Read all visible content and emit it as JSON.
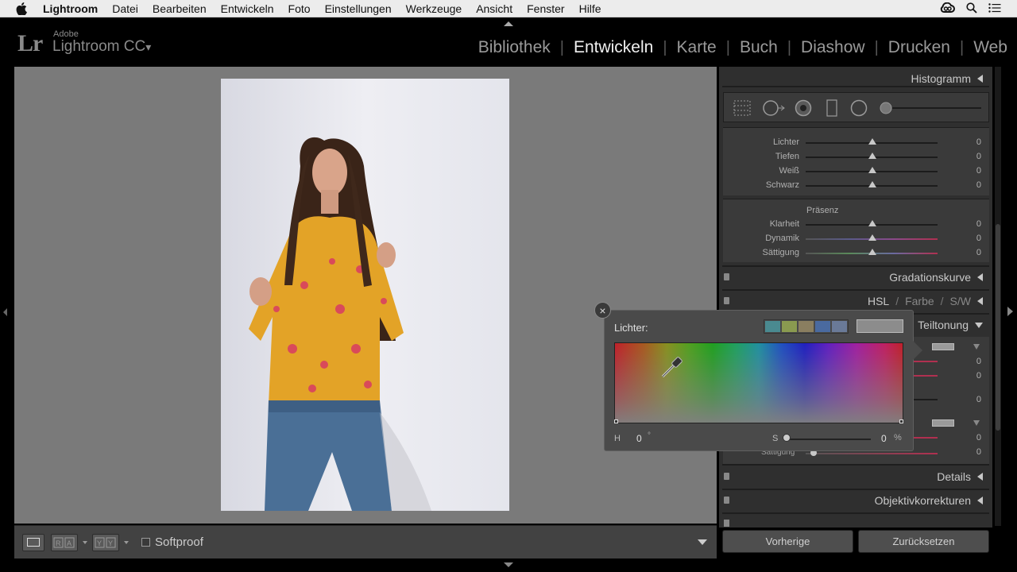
{
  "menubar": {
    "app_name": "Lightroom",
    "items": [
      "Datei",
      "Bearbeiten",
      "Entwickeln",
      "Foto",
      "Einstellungen",
      "Werkzeuge",
      "Ansicht",
      "Fenster",
      "Hilfe"
    ]
  },
  "header": {
    "logo": "Lr",
    "vendor": "Adobe",
    "product": "Lightroom CC",
    "product_caret": "▾",
    "modules": [
      {
        "label": "Bibliothek",
        "active": false
      },
      {
        "label": "Entwickeln",
        "active": true
      },
      {
        "label": "Karte",
        "active": false
      },
      {
        "label": "Buch",
        "active": false
      },
      {
        "label": "Diashow",
        "active": false
      },
      {
        "label": "Drucken",
        "active": false
      },
      {
        "label": "Web",
        "active": false
      }
    ],
    "separator": "|"
  },
  "toolbar": {
    "softproof_label": "Softproof"
  },
  "right_panel": {
    "histogram_label": "Histogramm",
    "tone_sliders": [
      {
        "label": "Lichter",
        "value": "0"
      },
      {
        "label": "Tiefen",
        "value": "0"
      },
      {
        "label": "Weiß",
        "value": "0"
      },
      {
        "label": "Schwarz",
        "value": "0"
      }
    ],
    "presence_label": "Präsenz",
    "presence_sliders": [
      {
        "label": "Klarheit",
        "value": "0"
      },
      {
        "label": "Dynamik",
        "value": "0"
      },
      {
        "label": "Sättigung",
        "value": "0"
      }
    ],
    "sections": {
      "gradation": "Gradationskurve",
      "hsl": "HSL",
      "farbe": "Farbe",
      "sw": "S/W",
      "split_toning": "Teiltonung",
      "details": "Details",
      "lens": "Objektivkorrekturen"
    },
    "split_values": [
      "0",
      "0",
      "0",
      "0",
      "0"
    ],
    "partial_label": "Sättigung",
    "buttons": {
      "previous": "Vorherige",
      "reset": "Zurücksetzen"
    }
  },
  "color_picker": {
    "title": "Lichter:",
    "swatch_colors": [
      "#4a8a90",
      "#8a9a50",
      "#8a7e60",
      "#4a6aa0",
      "#6a7a98"
    ],
    "h_label": "H",
    "h_value": "0",
    "h_unit": "°",
    "s_label": "S",
    "s_value": "0",
    "s_unit": "%"
  }
}
